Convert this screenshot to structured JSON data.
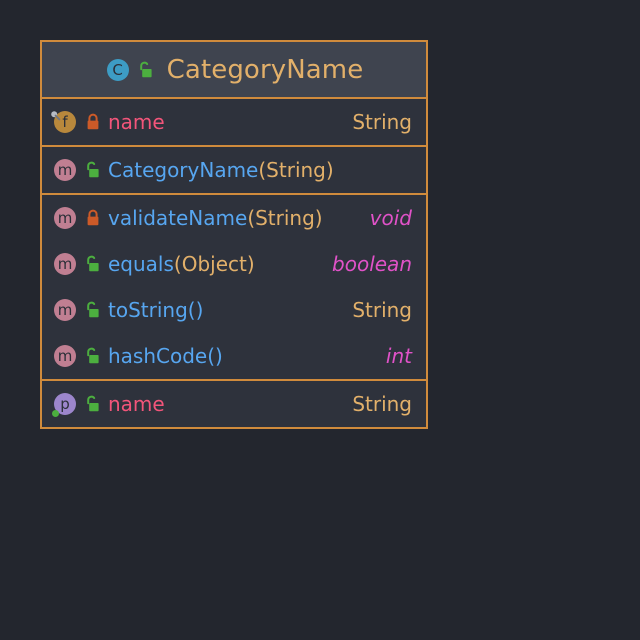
{
  "diagram": {
    "type": "uml-class-diagram",
    "background_color": "#23262e",
    "border_color": "#d08b3c",
    "header_background": "#3f444f",
    "row_background": "#2e323c"
  },
  "class_box": {
    "header": {
      "kind_icon": "class-icon",
      "kind_letter": "C",
      "visibility_icon": "unlocked-padlock-icon",
      "visibility": "public",
      "name": "CategoryName"
    },
    "fields": [
      {
        "kind_icon": "field-icon",
        "kind_letter": "f",
        "modifier_icon": "pin-final-icon",
        "visibility_icon": "locked-padlock-icon",
        "visibility": "private",
        "name": "name",
        "params": "",
        "type": "String",
        "type_is_primitive": false
      }
    ],
    "constructors": [
      {
        "kind_icon": "method-icon",
        "kind_letter": "m",
        "visibility_icon": "unlocked-padlock-icon",
        "visibility": "public",
        "name": "CategoryName",
        "params": "(String)",
        "type": "",
        "type_is_primitive": false
      }
    ],
    "methods": [
      {
        "kind_icon": "method-icon",
        "kind_letter": "m",
        "visibility_icon": "locked-padlock-icon",
        "visibility": "private",
        "name": "validateName",
        "params": "(String)",
        "type": "void",
        "type_is_primitive": true
      },
      {
        "kind_icon": "method-icon",
        "kind_letter": "m",
        "visibility_icon": "unlocked-padlock-icon",
        "visibility": "public",
        "name": "equals",
        "params": "(Object)",
        "type": "boolean",
        "type_is_primitive": true
      },
      {
        "kind_icon": "method-icon",
        "kind_letter": "m",
        "visibility_icon": "unlocked-padlock-icon",
        "visibility": "public",
        "name": "toString",
        "params": "()",
        "type": "String",
        "type_is_primitive": false
      },
      {
        "kind_icon": "method-icon",
        "kind_letter": "m",
        "visibility_icon": "unlocked-padlock-icon",
        "visibility": "public",
        "name": "hashCode",
        "params": "()",
        "type": "int",
        "type_is_primitive": true
      }
    ],
    "properties": [
      {
        "kind_icon": "property-icon",
        "kind_letter": "p",
        "accessor_icon": "getter-dot-icon",
        "visibility_icon": "unlocked-padlock-icon",
        "visibility": "public",
        "name": "name",
        "params": "",
        "type": "String",
        "type_is_primitive": false
      }
    ]
  },
  "colors": {
    "border": "#d08b3c",
    "class_name": "#e2b06a",
    "field_name": "#f2557a",
    "method_name": "#57a6f0",
    "type_ref": "#e2b06a",
    "type_primitive": "#e052c8",
    "icon_class": "#3d9cc4",
    "icon_field": "#b8883c",
    "icon_method": "#c07f92",
    "icon_property": "#9c86cc",
    "lock_public": "#4caf3f",
    "lock_private": "#cc5a28"
  }
}
